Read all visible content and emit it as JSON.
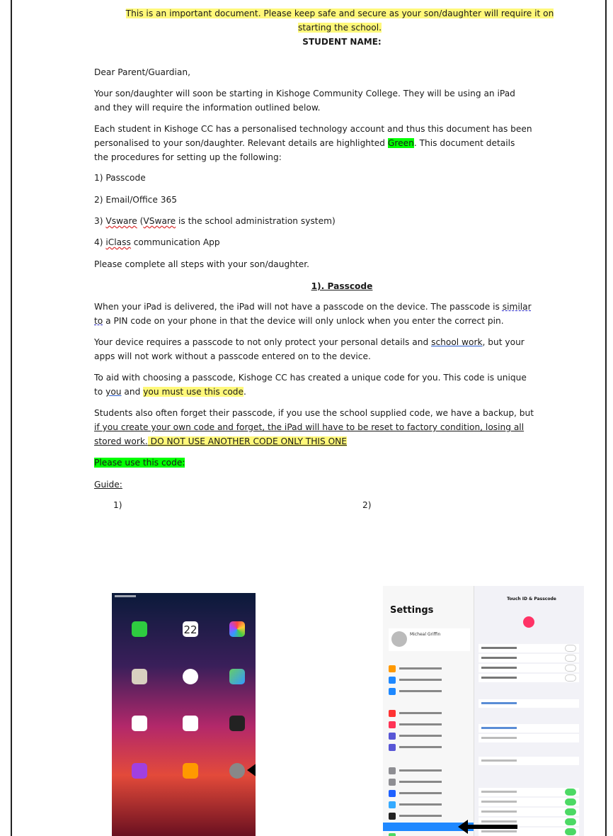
{
  "notice": {
    "line1": "This is an important document. Please keep safe and secure as your son/daughter will require it on",
    "line2": "starting the school."
  },
  "student_name_label": "STUDENT NAME:",
  "salutation": "Dear Parent/Guardian,",
  "intro": {
    "line1": "Your son/daughter will soon be starting in Kishoge Community College. They will be using an iPad",
    "line2": "and they will require the information outlined below."
  },
  "account": {
    "line1": "Each student in Kishoge CC has a personalised technology account and thus this document has been",
    "line2_a": "personalised to your son/daughter. Relevant details are highlighted ",
    "line2_green": "Green",
    "line2_b": ". This document details",
    "line3": "the procedures for setting up the following:"
  },
  "steps": {
    "s1": "1) Passcode",
    "s2": "2) Email/Office 365",
    "s3_a": "3) ",
    "s3_vsware": "Vsware",
    "s3_b": " (",
    "s3_vsware2": "VSware",
    "s3_c": " is the school administration system)",
    "s4_a": "4) ",
    "s4_iclass": "iClass",
    "s4_b": " communication App"
  },
  "complete_all": "Please complete all steps with your son/daughter.",
  "section_title": "1). Passcode",
  "delivered": {
    "line1_a": "When your iPad is delivered, the iPad will not have a passcode on the device. The passcode is ",
    "line1_similar": "similar",
    "line2_to": "to",
    "line2_b": " a PIN code on your phone in that the device will only unlock when you enter the correct pin."
  },
  "requires": {
    "line1_a": "Your device requires a passcode to not only protect your personal details and ",
    "line1_sw": "school work",
    "line1_b": ", but your",
    "line2": "apps will not work without a passcode entered on to the device."
  },
  "aid": {
    "line1": "To aid with choosing a passcode, Kishoge CC has created a unique code for you. This code is unique",
    "line2_a": "to ",
    "line2_you": "you",
    "line2_b": " and ",
    "line2_must": "you must use this code",
    "line2_c": "."
  },
  "forget": {
    "line1": "Students also often forget their passcode, if you use the school supplied code, we have a backup, but",
    "line2": "if you create your own code and forget, the iPad will have to be reset to factory condition, losing all",
    "line3_a": "stored work.",
    "line3_b": " DO NOT USE ANOTHER CODE ONLY THIS ONE"
  },
  "use_code": "Please use this code:",
  "guide": "Guide:",
  "fig1_label": "1)",
  "fig2_label": "2)",
  "ipad_date": "22",
  "settings_title": "Settings",
  "settings_user": "Micheal Griffin",
  "settings_header": "Touch ID & Passcode",
  "colors": {
    "highlight_yellow": "#fff87a",
    "highlight_green": "#00ff00",
    "arrow": "#000000"
  }
}
